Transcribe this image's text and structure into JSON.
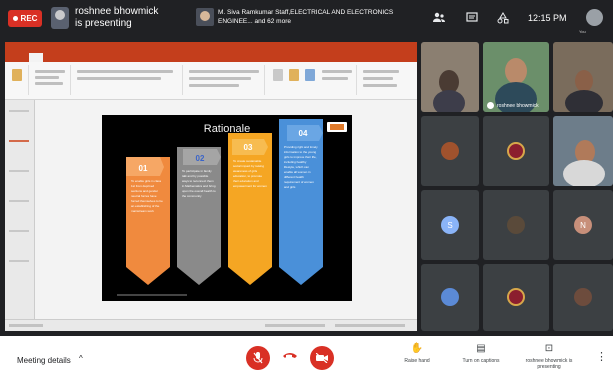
{
  "top_bar": {
    "rec_label": "REC",
    "presenter_text": "roshnee bhowmick is presenting",
    "meeting_info": "M. Siva Ramkumar Staff,ELECTRICAL AND ELECTRONICS ENGINEE... and 62 more",
    "clock": "12:15 PM",
    "self_label": "You",
    "icons": [
      "people-icon",
      "chat-icon",
      "activities-icon"
    ]
  },
  "presentation": {
    "slide": {
      "title": "Rationale",
      "cards": [
        {
          "number": "01",
          "color": "#f08a3e",
          "text": "To enable girls in class 1st from deprived sections and gender neutral forces have forced themselves to be an establishing of the mainstream work"
        },
        {
          "number": "02",
          "color": "#8a8a8a",
          "text": "To participate in family talk and by possible ways to reconnect them in Mathematics and bring upon the overall health to the community"
        },
        {
          "number": "03",
          "color": "#f5a623",
          "text": "To create sustainable social impact by raising awareness of girls education, to promote their education and empowerment for women"
        },
        {
          "number": "04",
          "color": "#4a90d9",
          "text": "Providing right and timely information to the young girls to improve their life, including healthy lifestyle, which can enable all women in different health requirement of women and girls"
        }
      ]
    }
  },
  "participants": [
    {
      "type": "photo",
      "bg": "#8b7f71"
    },
    {
      "type": "photo",
      "bg": "#6b8f6a",
      "label": "roshnee bhowmick"
    },
    {
      "type": "photo",
      "bg": "#7a6c5c"
    },
    {
      "type": "photo-avatar",
      "bg": "#a0522d"
    },
    {
      "type": "emblem",
      "bg": "#8b1e2e"
    },
    {
      "type": "photo",
      "bg": "#6d7d8a"
    },
    {
      "type": "letter",
      "letter": "S",
      "bg": "#8ab4f8"
    },
    {
      "type": "photo-avatar",
      "bg": "#5a4a3a"
    },
    {
      "type": "letter",
      "letter": "N",
      "bg": "#c78f7a"
    },
    {
      "type": "globe",
      "bg": "#5b8ad6"
    },
    {
      "type": "emblem",
      "bg": "#8b1e2e"
    },
    {
      "type": "photo-avatar",
      "bg": "#6d4c3d"
    }
  ],
  "bottom_bar": {
    "meeting_details": "Meeting details",
    "raise_hand": "Raise hand",
    "captions": "Turn on captions",
    "presenting": "roshnee bhowmick is presenting",
    "mic_color": "#d93025",
    "cam_color": "#d93025"
  }
}
